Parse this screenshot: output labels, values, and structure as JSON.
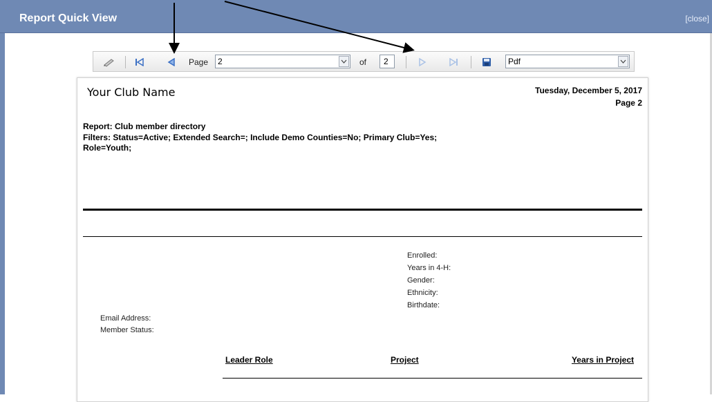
{
  "window": {
    "title": "Report Quick View",
    "close_label": "[close]"
  },
  "toolbar": {
    "page_label": "Page",
    "page_value": "2",
    "of_label": "of",
    "total_pages": "2",
    "format_value": "Pdf",
    "icons": [
      "edit-icon",
      "first-page-icon",
      "previous-page-icon",
      "next-page-icon",
      "last-page-icon",
      "save-icon"
    ]
  },
  "report": {
    "club_name": "Your Club Name",
    "date": "Tuesday, December 5, 2017",
    "page_text": "Page 2",
    "report_line": "Report: Club member directory",
    "filters_line1": "Filters: Status=Active; Extended Search=; Include Demo Counties=No; Primary Club=Yes;",
    "filters_line2": "Role=Youth;",
    "fields_right": [
      "Enrolled:",
      "Years in 4-H:",
      "Gender:",
      "Ethnicity:",
      "Birthdate:"
    ],
    "fields_left": [
      "Email Address:",
      "Member Status:"
    ],
    "columns": [
      "Leader Role",
      "Project",
      "Years in Project"
    ]
  },
  "colors": {
    "header": "#6f89b4",
    "accent_icon": "#3a6fc4"
  }
}
